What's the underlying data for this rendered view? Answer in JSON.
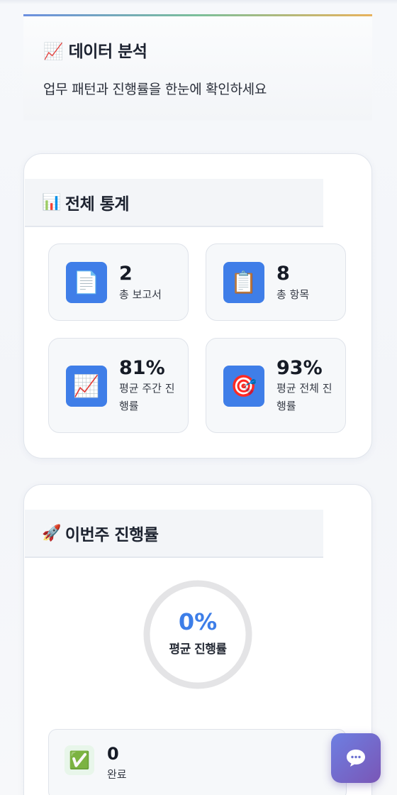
{
  "header": {
    "title": "📈 데이터 분석",
    "subtitle": "업무 패턴과 진행률을 한눈에 확인하세요"
  },
  "overall": {
    "title_emoji": "📊",
    "title": "전체 통계",
    "stats": [
      {
        "icon": "document-icon",
        "emoji": "📄",
        "value": "2",
        "label": "총 보고서"
      },
      {
        "icon": "clipboard-icon",
        "emoji": "📋",
        "value": "8",
        "label": "총 항목"
      },
      {
        "icon": "chart-increasing-icon",
        "emoji": "📈",
        "value": "81%",
        "label": "평균 주간 진행률"
      },
      {
        "icon": "target-icon",
        "emoji": "🎯",
        "value": "93%",
        "label": "평균 전체 진행률"
      }
    ]
  },
  "weekly": {
    "title_emoji": "🚀",
    "title": "이번주 진행률",
    "progress_value": "0%",
    "progress_fraction": 0,
    "progress_label": "평균 진행률",
    "done": {
      "emoji": "✅",
      "value": "0",
      "label": "완료"
    }
  },
  "colors": {
    "accent": "#3f7ee8",
    "ring_track": "#e4e4e6",
    "chat_button_start": "#6d7fe2",
    "chat_button_end": "#7a56b6"
  },
  "chat": {
    "icon": "chat-bubble-icon"
  }
}
